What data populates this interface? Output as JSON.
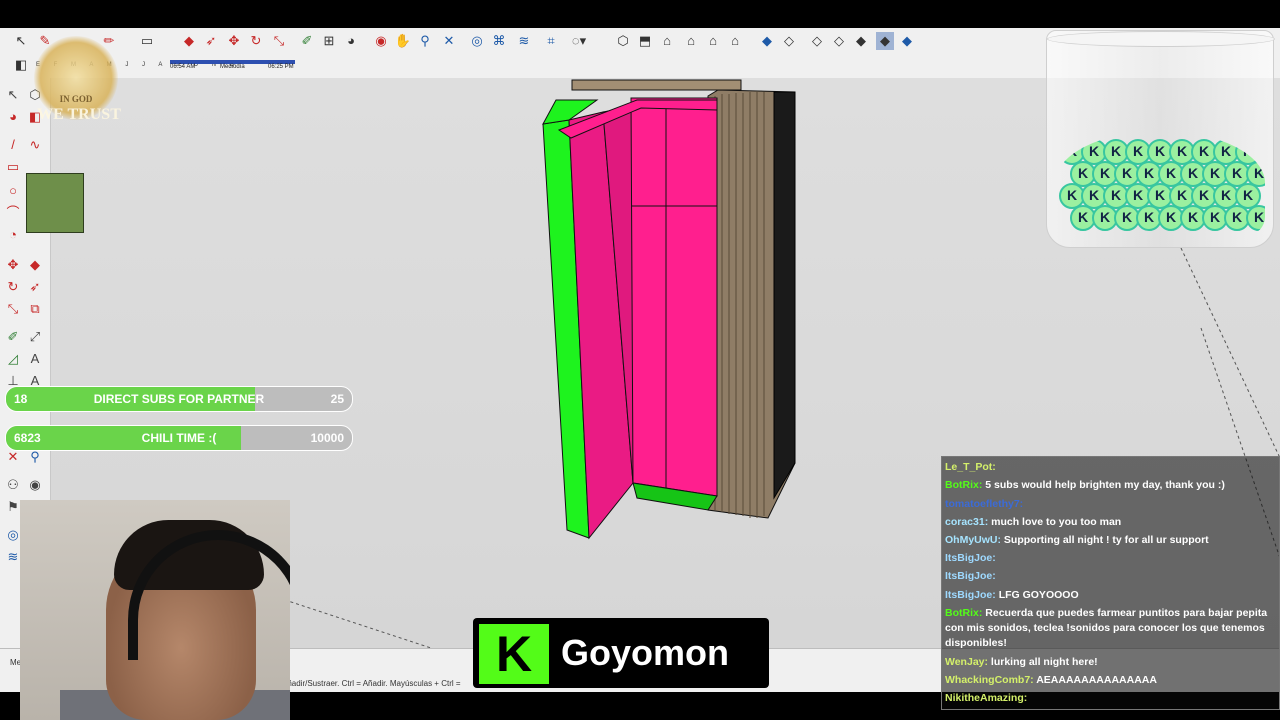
{
  "app": {
    "sun_panel": {
      "months": "E F M A M J J A S O N D",
      "time_start": "06:54 AM",
      "time_mid": "Mediodía",
      "time_end": "06:25 PM"
    },
    "status": {
      "measurements_label": "Medidas",
      "hint": "Añadir/Sustraer. Ctrl = Añadir. Mayúsculas + Ctrl ="
    }
  },
  "overlay": {
    "logo_text_1": "IN GOD",
    "logo_text_2": "WE TRUST",
    "goals": [
      {
        "current": "18",
        "title": "DIRECT SUBS FOR PARTNER",
        "target": "25",
        "progress": 0.72
      },
      {
        "current": "6823",
        "title": "CHILI TIME :(",
        "target": "10000",
        "progress": 0.68
      }
    ],
    "kick": {
      "logo": "K",
      "name": "Goyomon"
    },
    "chat": [
      {
        "user": "Le_T_Pot:",
        "msg": "",
        "color": "#d4f06a"
      },
      {
        "user": "BotRix:",
        "msg": "5 subs would help brighten my day, thank you :)",
        "color": "#53fc18"
      },
      {
        "user": "tomatoeflethy7:",
        "msg": "",
        "color": "#3b6bd8"
      },
      {
        "user": "corac31:",
        "msg": "much love to you too man",
        "color": "#a6e4ff"
      },
      {
        "user": "OhMyUwU:",
        "msg": "Supporting all night ! ty for all ur support",
        "color": "#a6e4ff"
      },
      {
        "user": "ItsBigJoe:",
        "msg": "",
        "color": "#9ed9ff"
      },
      {
        "user": "ItsBigJoe:",
        "msg": "",
        "color": "#9ed9ff"
      },
      {
        "user": "ItsBigJoe:",
        "msg": "LFG GOYOOOO",
        "color": "#9ed9ff"
      },
      {
        "user": "BotRix:",
        "msg": "Recuerda que puedes farmear puntitos para bajar pepita con mis sonidos, teclea !sonidos para conocer los que tenemos disponibles!",
        "color": "#53fc18"
      },
      {
        "user": "WenJay:",
        "msg": "lurking all night here!",
        "color": "#d4f06a"
      },
      {
        "user": "WhackingComb7:",
        "msg": "AEAAAAAAAAAAAAAA",
        "color": "#d4f06a"
      },
      {
        "user": "NikitheAmazing:",
        "msg": "",
        "color": "#d4f06a"
      }
    ]
  },
  "colors": {
    "kick_green": "#53fc18",
    "goal_fill": "#6ad44a",
    "model_pink": "#ff1f8e",
    "model_green": "#1ef31e",
    "model_wood": "#a38f74"
  }
}
